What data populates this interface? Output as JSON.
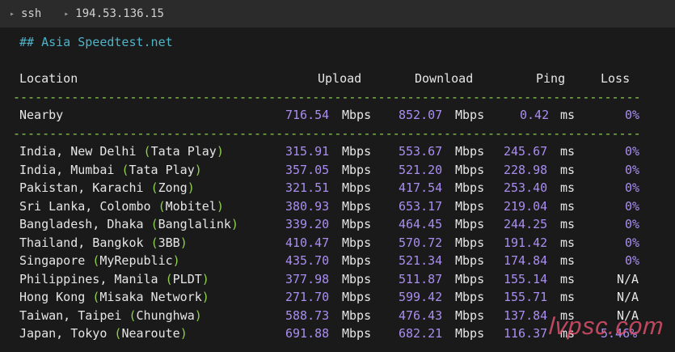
{
  "titlebar": {
    "segments": [
      "ssh",
      "194.53.136.15"
    ]
  },
  "heading": "## Asia Speedtest.net",
  "columns": {
    "location": "Location",
    "upload": "Upload",
    "download": "Download",
    "ping": "Ping",
    "loss": "Loss"
  },
  "nearby": {
    "location": "Nearby",
    "upload": "716.54",
    "upload_unit": "Mbps",
    "download": "852.07",
    "download_unit": "Mbps",
    "ping": "0.42",
    "ping_unit": "ms",
    "loss": "0%"
  },
  "rows": [
    {
      "place": "India, New Delhi",
      "isp": "Tata Play",
      "upload": "315.91",
      "download": "553.67",
      "ping": "245.67",
      "loss": "0%"
    },
    {
      "place": "India, Mumbai",
      "isp": "Tata Play",
      "upload": "357.05",
      "download": "521.20",
      "ping": "228.98",
      "loss": "0%"
    },
    {
      "place": "Pakistan, Karachi",
      "isp": "Zong",
      "upload": "321.51",
      "download": "417.54",
      "ping": "253.40",
      "loss": "0%"
    },
    {
      "place": "Sri Lanka, Colombo",
      "isp": "Mobitel",
      "upload": "380.93",
      "download": "653.17",
      "ping": "219.04",
      "loss": "0%"
    },
    {
      "place": "Bangladesh, Dhaka",
      "isp": "Banglalink",
      "upload": "339.20",
      "download": "464.45",
      "ping": "244.25",
      "loss": "0%"
    },
    {
      "place": "Thailand, Bangkok",
      "isp": "3BB",
      "upload": "410.47",
      "download": "570.72",
      "ping": "191.42",
      "loss": "0%"
    },
    {
      "place": "Singapore",
      "isp": "MyRepublic",
      "upload": "435.70",
      "download": "521.34",
      "ping": "174.84",
      "loss": "0%"
    },
    {
      "place": "Philippines, Manila",
      "isp": "PLDT",
      "upload": "377.98",
      "download": "511.87",
      "ping": "155.14",
      "loss": "N/A"
    },
    {
      "place": "Hong Kong",
      "isp": "Misaka Network",
      "upload": "271.70",
      "download": "599.42",
      "ping": "155.71",
      "loss": "N/A"
    },
    {
      "place": "Taiwan, Taipei",
      "isp": "Chunghwa",
      "upload": "588.73",
      "download": "476.43",
      "ping": "137.84",
      "loss": "N/A"
    },
    {
      "place": "Japan, Tokyo",
      "isp": "Nearoute",
      "upload": "691.88",
      "download": "682.21",
      "ping": "116.37",
      "loss": "5.46%"
    }
  ],
  "units": {
    "speed": "Mbps",
    "ping": "ms"
  },
  "dash_line": "-----------------------------------------------------------------------------------------",
  "watermark": "lvpsc.com",
  "colors": {
    "heading": "#4fb3c7",
    "dash": "#8fd14f",
    "number": "#a98ef0",
    "paren": "#8fd14f"
  }
}
